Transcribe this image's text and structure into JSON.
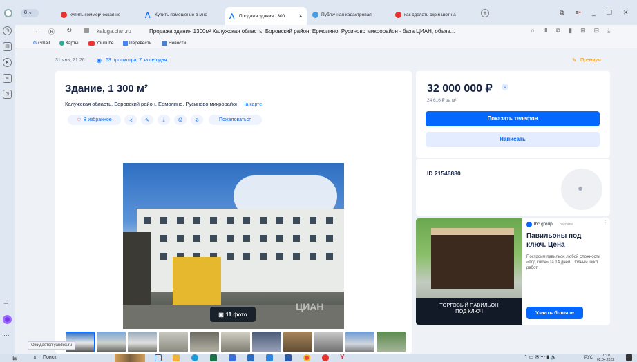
{
  "tabs": [
    {
      "label": "купить коммерческая не",
      "icon": "yandex-icon"
    },
    {
      "label": "Купить помещение в мно",
      "icon": "cian-icon"
    },
    {
      "label": "Продажа здания 1300",
      "icon": "cian-icon"
    },
    {
      "label": "Публичная кадастровая",
      "icon": "map-icon"
    },
    {
      "label": "как сделать скриншот на",
      "icon": "yandex-icon"
    }
  ],
  "tab_count_badge": "8",
  "address": {
    "domain": "kaluga.cian.ru",
    "title": "Продажа здания 1300м² Калужская область, Боровский район, Ермолино, Русиново микрорайон - база ЦИАН, объяв..."
  },
  "bookmarks": [
    "Gmail",
    "Карты",
    "YouTube",
    "Перевести",
    "Новости"
  ],
  "meta": {
    "date": "31 янв, 21:26",
    "views": "63 просмотра, 7 за сегодня",
    "premium": "Премиум"
  },
  "listing": {
    "title": "Здание, 1 300 м²",
    "address": "Калужская область, Боровский район, Ермолино, Русиново микрорайон",
    "map_link": "На карте",
    "favorite": "В избранное",
    "complain": "Пожаловаться",
    "photo_count": "11 фото",
    "watermark": "ЦИАН"
  },
  "price": {
    "value": "32 000 000 ₽",
    "per_m2": "24 616 ₽ за м²",
    "show_phone": "Показать телефон",
    "write": "Написать"
  },
  "agent": {
    "id": "ID 21546880"
  },
  "ad": {
    "brand": "lbc.group",
    "tag": "реклама",
    "title": "Павильоны под ключ. Цена",
    "text": "Построим павильон любой сложности «под ключ» за 14 дней. Полный цикл работ.",
    "image_caption": "ТОРГОВЫЙ ПАВИЛЬОН ПОД КЛЮЧ",
    "cta": "Узнать больше"
  },
  "status": "Ожидается yandex.ru",
  "taskbar": {
    "search": "Поиск",
    "lang": "РУС",
    "time": "0:07",
    "date": "02.04.2022"
  }
}
